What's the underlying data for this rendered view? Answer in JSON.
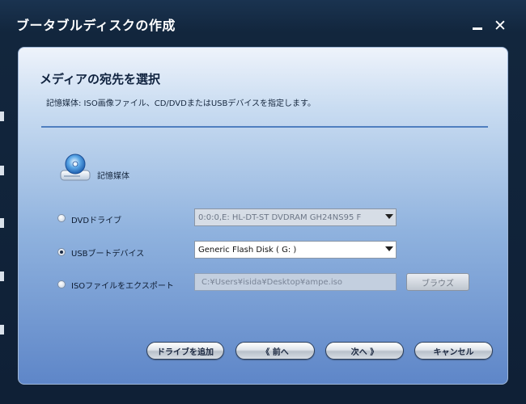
{
  "window": {
    "title": "ブータブルディスクの作成",
    "minimize": "—",
    "close": "✕"
  },
  "page": {
    "heading": "メディアの宛先を選択",
    "description": "記憶媒体: ISO画像ファイル、CD/DVDまたはUSBデバイスを指定します。"
  },
  "media": {
    "label": "記憶媒体",
    "icon": "disc-drive-icon"
  },
  "options": {
    "dvd": {
      "label": "DVDドライブ",
      "selected": false,
      "value": "0:0:0,E: HL-DT-ST DVDRAM GH24NS95  F"
    },
    "usb": {
      "label": "USBブートデバイス",
      "selected": true,
      "value": "Generic Flash Disk      ( G: )"
    },
    "iso": {
      "label": "ISOファイルをエクスポート",
      "selected": false,
      "value": "C:¥Users¥isida¥Desktop¥ampe.iso",
      "browse_label": "ブラウズ"
    }
  },
  "buttons": {
    "add_drive": "ドライブを追加",
    "back": "《 前へ",
    "next": "次へ 》",
    "cancel": "キャンセル"
  },
  "colors": {
    "window_bg": "#0f2036",
    "panel_top": "#eef3fb",
    "panel_bottom": "#5e86c8",
    "divider": "#4f7fbf"
  }
}
